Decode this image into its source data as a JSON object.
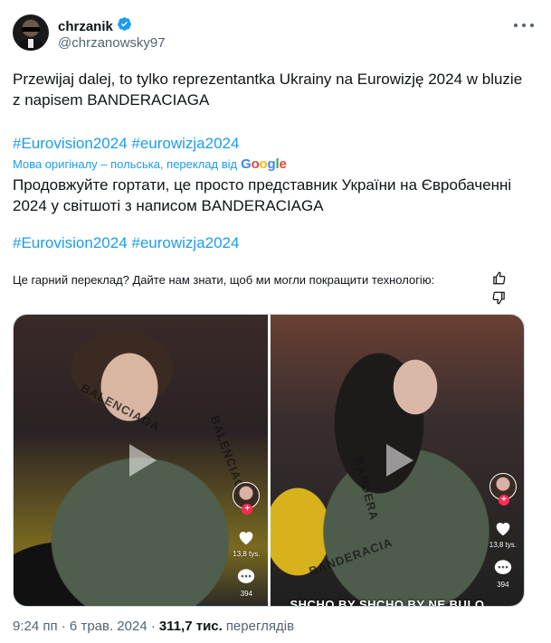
{
  "author": {
    "display_name": "chrzanik",
    "handle": "@chrzanowsky97",
    "verified": true
  },
  "tweet": {
    "text": "Przewijaj dalej, to tylko reprezentantka Ukrainy na Eurowizję 2024 w bluzie z napisem BANDERACIAGA",
    "hashtags": "#Eurovision2024 #eurowizja2024"
  },
  "translation": {
    "note": "Мова оригіналу – польська, переклад від",
    "provider": "Google",
    "text": "Продовжуйте гортати, це просто представник України на Євробаченні 2024 у світшоті з написом BANDERACIAGA",
    "hashtags": "#Eurovision2024 #eurowizja2024",
    "feedback_question": "Це гарний переклад? Дайте нам знати, щоб ми могли покращити технологію:"
  },
  "media": [
    {
      "jacket_text_1": "BALENCIAGA",
      "jacket_text_2": "BALENCIAGA",
      "likes": "13,8 tys.",
      "comments": "394"
    },
    {
      "jacket_text_1": "BANDERA",
      "jacket_text_2": "BANDERACIA",
      "likes": "13,8 tys.",
      "comments": "394",
      "caption": "SHCHO BY SHCHO BY NE BULO"
    }
  ],
  "footer": {
    "time_date": "9:24 пп · 6 трав. 2024 ·",
    "views_count": "311,7 тис.",
    "views_label": "переглядів"
  },
  "colors": {
    "link": "#1d9bf0",
    "secondary_text": "#536471",
    "verified": "#1d9bf0",
    "tiktok_red": "#fe2c55"
  }
}
